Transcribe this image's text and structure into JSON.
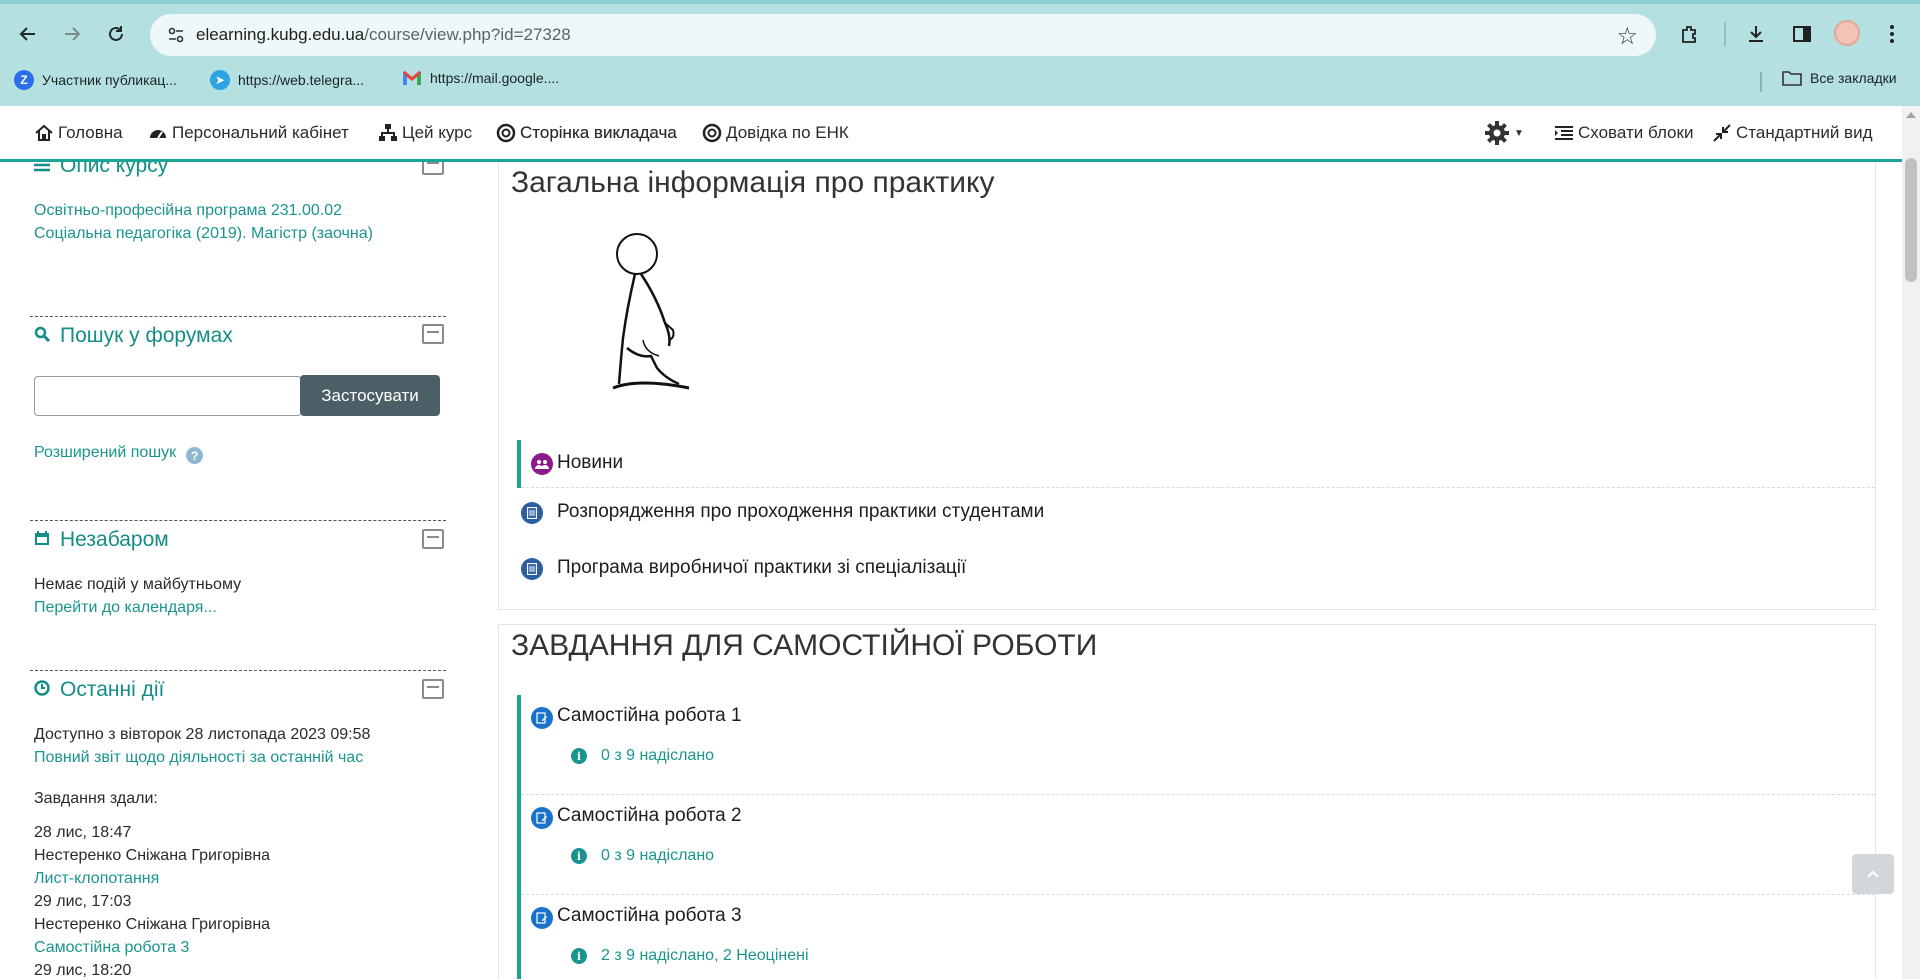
{
  "browser": {
    "url_host": "elearning.kubg.edu.ua",
    "url_path": "/course/view.php?id=27328",
    "bookmarks": [
      {
        "label": "Участник публикац...",
        "icon": "z-logo-icon"
      },
      {
        "label": "https://web.telegra...",
        "icon": "telegram-icon"
      },
      {
        "label": "https://mail.google....",
        "icon": "gmail-icon"
      }
    ],
    "all_bookmarks_label": "Все закладки"
  },
  "navbar": {
    "items": [
      "Головна",
      "Персональний кабінет",
      "Цей курс",
      "Сторінка викладача",
      "Довідка по ЕНК"
    ],
    "hide_blocks": "Сховати блоки",
    "standard_view": "Стандартний вид"
  },
  "sidebar": {
    "course_desc": {
      "title": "Опис курсу",
      "line1": "Освітньо-професійна програма 231.00.02",
      "line2": "Соціальна педагогіка (2019). Магістр (заочна)"
    },
    "forum_search": {
      "title": "Пошук у форумах",
      "input_value": "",
      "apply_label": "Застосувати",
      "advanced_label": "Розширений пошук"
    },
    "upcoming": {
      "title": "Незабаром",
      "no_events": "Немає подій у майбутньому",
      "calendar_link": "Перейти до календаря..."
    },
    "recent": {
      "title": "Останні дії",
      "available_since": "Доступно з вівторок 28 листопада 2023 09:58",
      "full_report": "Повний звіт щодо діяльності за останній час",
      "submitted_heading": "Завдання здали:",
      "entries": [
        {
          "time": "28 лис, 18:47",
          "name": "Нестеренко Сніжана Григорівна",
          "task": "Лист-клопотання"
        },
        {
          "time": "29 лис, 17:03",
          "name": "Нестеренко Сніжана Григорівна",
          "task": "Самостійна робота 3"
        },
        {
          "time": "29 лис, 18:20"
        }
      ]
    }
  },
  "main": {
    "section1": {
      "title": "Загальна інформація про практику",
      "activities": [
        {
          "name": "Новини",
          "icon": "forum-icon"
        },
        {
          "name": "Розпорядження про проходження практики студентами",
          "icon": "file-icon"
        },
        {
          "name": "Програма виробничої практики зі спеціалізації",
          "icon": "file-icon"
        }
      ]
    },
    "section2": {
      "title": "ЗАВДАННЯ ДЛЯ САМОСТІЙНОЇ РОБОТИ",
      "assignments": [
        {
          "name": "Самостійна робота 1",
          "status": "0 з 9 надіслано"
        },
        {
          "name": "Самостійна робота 2",
          "status": "0 з 9 надіслано"
        },
        {
          "name": "Самостійна робота 3",
          "status": "2 з 9 надіслано, 2 Неоцінені"
        }
      ]
    }
  },
  "colors": {
    "accent": "#19a596",
    "link": "#1a958e",
    "browser_frame": "#b5e0e2",
    "button_dark": "#4c5f66"
  }
}
